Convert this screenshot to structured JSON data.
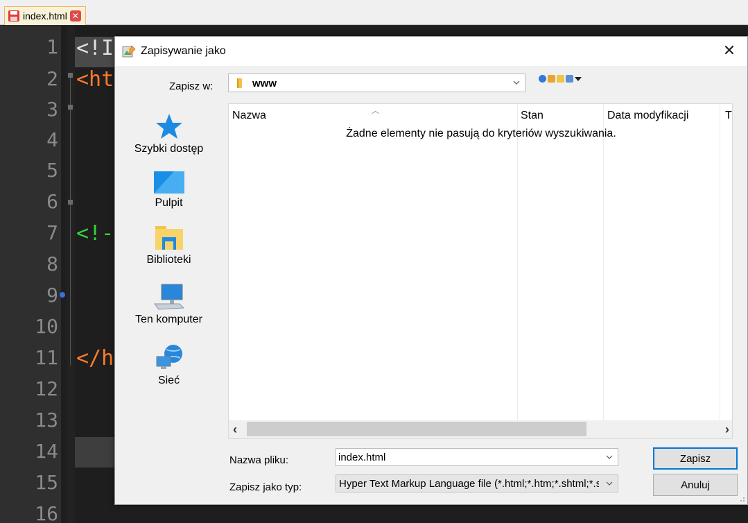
{
  "editor": {
    "tab_label": "index.html",
    "line_numbers": [
      "1",
      "2",
      "3",
      "4",
      "5",
      "6",
      "7",
      "8",
      "9",
      "10",
      "11",
      "12",
      "13",
      "14",
      "15",
      "16"
    ],
    "code_fragments": {
      "line1": "<!I",
      "line2": "<ht",
      "line7": "<!-",
      "line11": "</h"
    }
  },
  "dialog": {
    "title": "Zapisywanie jako",
    "close_glyph": "✕",
    "look_in": {
      "label": "Zapisz w:",
      "value": "www"
    },
    "places": [
      {
        "label": "Szybki dostęp",
        "icon": "star-icon"
      },
      {
        "label": "Pulpit",
        "icon": "desktop-icon"
      },
      {
        "label": "Biblioteki",
        "icon": "libraries-icon"
      },
      {
        "label": "Ten komputer",
        "icon": "computer-icon"
      },
      {
        "label": "Sieć",
        "icon": "network-icon"
      }
    ],
    "file_list": {
      "columns": [
        "Nazwa",
        "Stan",
        "Data modyfikacji",
        "T"
      ],
      "empty_message": "Żadne elementy nie pasują do kryteriów wyszukiwania."
    },
    "file_name": {
      "label": "Nazwa pliku:",
      "value": "index.html"
    },
    "file_type": {
      "label": "Zapisz jako typ:",
      "value": "Hyper Text Markup Language file (*.html;*.htm;*.shtml;*.shtm;*.xhtml;*.xht;*.hta)"
    },
    "buttons": {
      "save": "Zapisz",
      "cancel": "Anuluj"
    }
  }
}
